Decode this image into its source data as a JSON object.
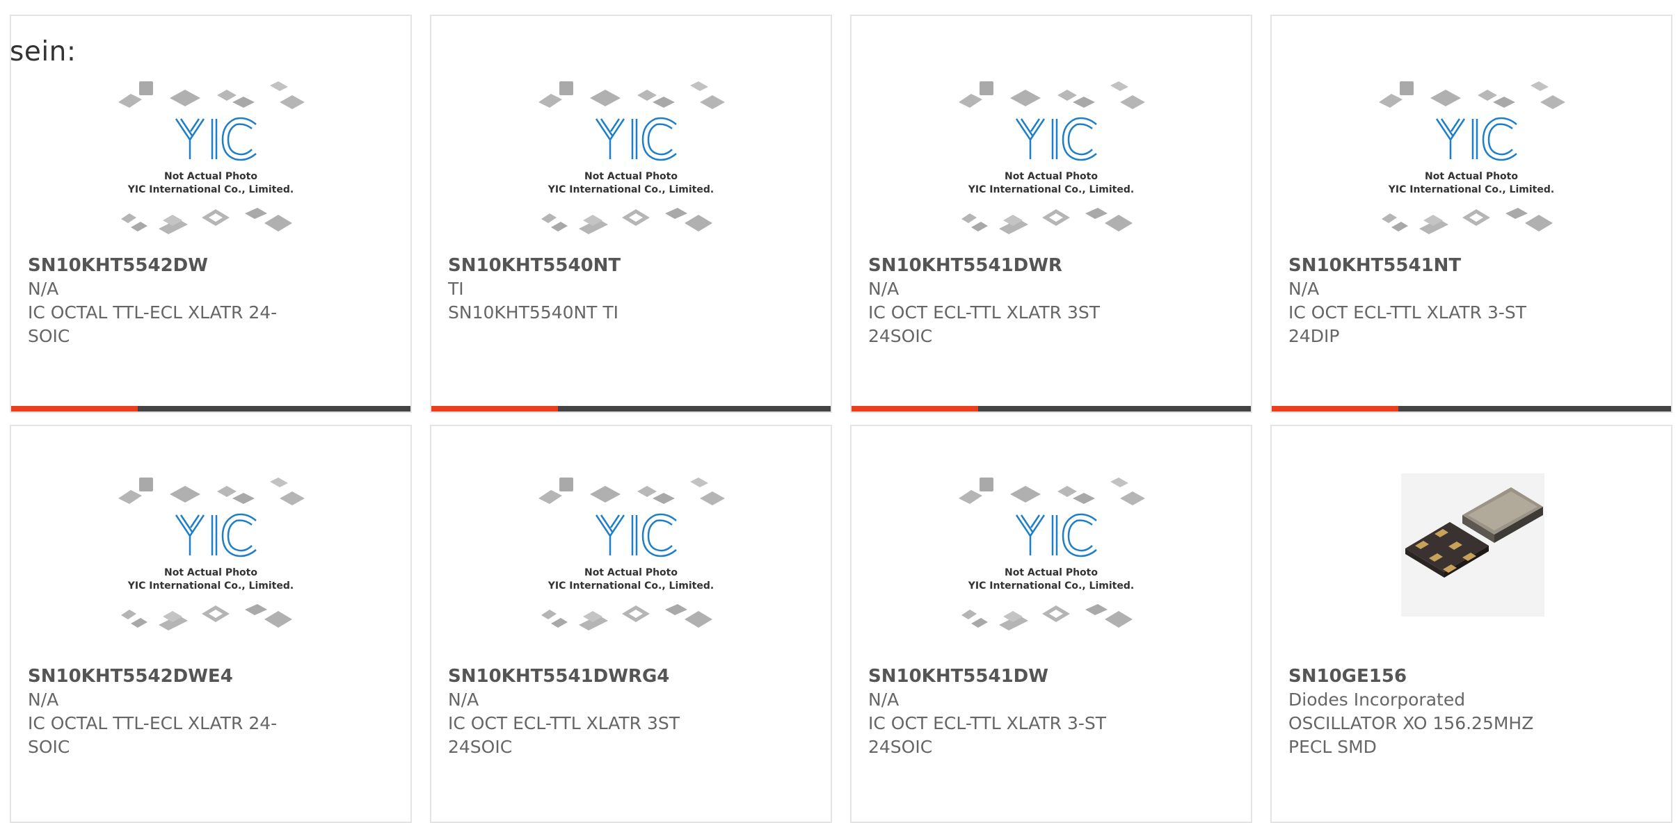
{
  "intro": "sein:",
  "colors": {
    "accent": "#ee3d1a",
    "bar": "#444444",
    "logo": "#1d7ec9",
    "chip": "#b5b5b5"
  },
  "placeholder_image": {
    "icon": "yic-placeholder-image",
    "line1": "Not Actual Photo",
    "line2": "YIC International Co., Limited."
  },
  "products": [
    {
      "part": "SN10KHT5542DW",
      "maker": "N/A",
      "desc": "IC OCTAL TTL-ECL XLATR 24-SOIC"
    },
    {
      "part": "SN10KHT5540NT",
      "maker": "TI",
      "desc": "SN10KHT5540NT TI"
    },
    {
      "part": "SN10KHT5541DWR",
      "maker": "N/A",
      "desc": "IC OCT ECL-TTL XLATR 3ST 24SOIC"
    },
    {
      "part": "SN10KHT5541NT",
      "maker": "N/A",
      "desc": "IC OCT ECL-TTL XLATR 3-ST 24DIP"
    },
    {
      "part": "SN10KHT5542DWE4",
      "maker": "N/A",
      "desc": "IC OCTAL TTL-ECL XLATR 24-SOIC"
    },
    {
      "part": "SN10KHT5541DWRG4",
      "maker": "N/A",
      "desc": "IC OCT ECL-TTL XLATR 3ST 24SOIC"
    },
    {
      "part": "SN10KHT5541DW",
      "maker": "N/A",
      "desc": "IC OCT ECL-TTL XLATR 3-ST 24SOIC"
    },
    {
      "part": "SN10GE156",
      "maker": "Diodes Incorporated",
      "desc": "OSCILLATOR XO 156.25MHZ PECL SMD",
      "icon": "oscillator-photo"
    }
  ]
}
